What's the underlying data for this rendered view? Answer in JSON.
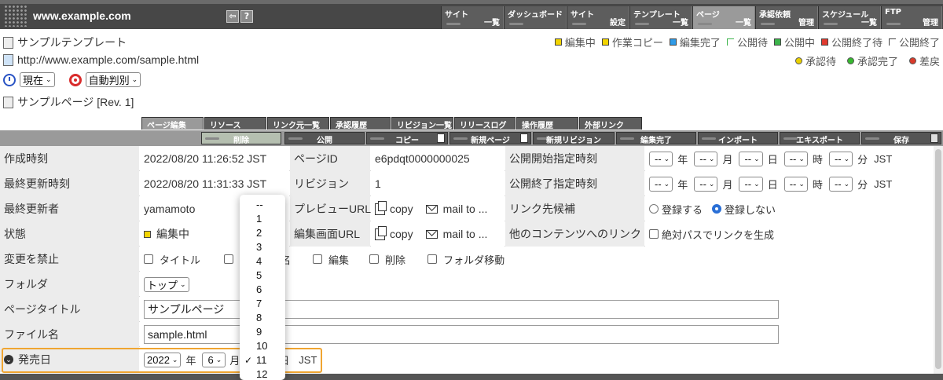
{
  "topbar": {
    "url": "www.example.com",
    "nav": [
      {
        "t1": "サイト",
        "t2": "一覧"
      },
      {
        "t1": "ダッシュボード",
        "t2": ""
      },
      {
        "t1": "サイト",
        "t2": "設定"
      },
      {
        "t1": "テンプレート",
        "t2": "一覧"
      },
      {
        "t1": "ページ",
        "t2": "一覧"
      },
      {
        "t1": "承認依頼",
        "t2": "管理"
      },
      {
        "t1": "スケジュール",
        "t2": "一覧"
      },
      {
        "t1": "FTP",
        "t2": "管理"
      }
    ]
  },
  "header": {
    "template_name": "サンプルテンプレート",
    "page_url": "http://www.example.com/sample.html",
    "time_select": "現在",
    "judge_select": "自動判別",
    "page_name": "サンプルページ [Rev. 1]"
  },
  "legend": {
    "status": [
      {
        "label": "編集中",
        "color": "#f2d400"
      },
      {
        "label": "作業コピー",
        "color": "#f2d400"
      },
      {
        "label": "編集完了",
        "color": "#2f9be8"
      },
      {
        "label": "公開待",
        "color": "#3cb44b"
      },
      {
        "label": "公開中",
        "color": "#3cb44b"
      },
      {
        "label": "公開終了待",
        "color": "#e03a2f"
      },
      {
        "label": "公開終了",
        "color": "#ffffff"
      }
    ],
    "approval": [
      {
        "label": "承認待",
        "color": "#e9d000"
      },
      {
        "label": "承認完了",
        "color": "#36b82f"
      },
      {
        "label": "差戻",
        "color": "#d93a2a"
      }
    ]
  },
  "tabs": [
    "ページ編集",
    "リソース",
    "リンク元一覧",
    "承認履歴",
    "リビジョン一覧",
    "リリースログ",
    "操作履歴",
    "外部リンク"
  ],
  "actions": [
    "削除",
    "公開",
    "コピー",
    "新規ページ",
    "新規リビジョン",
    "編集完了",
    "インポート",
    "エキスポート",
    "保存"
  ],
  "form": {
    "created_label": "作成時刻",
    "created_value": "2022/08/20 11:26:52 JST",
    "updated_label": "最終更新時刻",
    "updated_value": "2022/08/20 11:31:33 JST",
    "updater_label": "最終更新者",
    "updater_value": "yamamoto",
    "status_label": "状態",
    "status_value": "編集中",
    "lock_label": "変更を禁止",
    "lock_options": [
      "タイトル",
      "名",
      "編集",
      "削除",
      "フォルダ移動"
    ],
    "folder_label": "フォルダ",
    "folder_value": "トップ",
    "title_label": "ページタイトル",
    "title_value": "サンプルページ",
    "filename_label": "ファイル名",
    "filename_value": "sample.html",
    "release_label": "発売日",
    "release_year": "2022",
    "release_year_unit": "年",
    "release_month": "6",
    "release_month_unit": "月",
    "release_day_unit": "日",
    "release_tz": "JST",
    "pageid_label": "ページID",
    "pageid_value": "e6pdqt0000000025",
    "revision_label": "リビジョン",
    "revision_value": "1",
    "preview_label": "プレビューURL",
    "edit_url_label": "編集画面URL",
    "copy_text": "copy",
    "mailto_text": "mail to ...",
    "pub_start_label": "公開開始指定時刻",
    "pub_end_label": "公開終了指定時刻",
    "dt_placeholder": "--",
    "unit_year": "年",
    "unit_month": "月",
    "unit_day": "日",
    "unit_hour": "時",
    "unit_min": "分",
    "jst": "JST",
    "link_candidate_label": "リンク先候補",
    "register_yes": "登録する",
    "register_no": "登録しない",
    "other_link_label": "他のコンテンツへのリンク",
    "abs_path_label": "絶対パスでリンクを生成"
  },
  "dropdown": {
    "options": [
      "--",
      "1",
      "2",
      "3",
      "4",
      "5",
      "6",
      "7",
      "8",
      "9",
      "10",
      "11",
      "12"
    ],
    "selected": "11"
  }
}
